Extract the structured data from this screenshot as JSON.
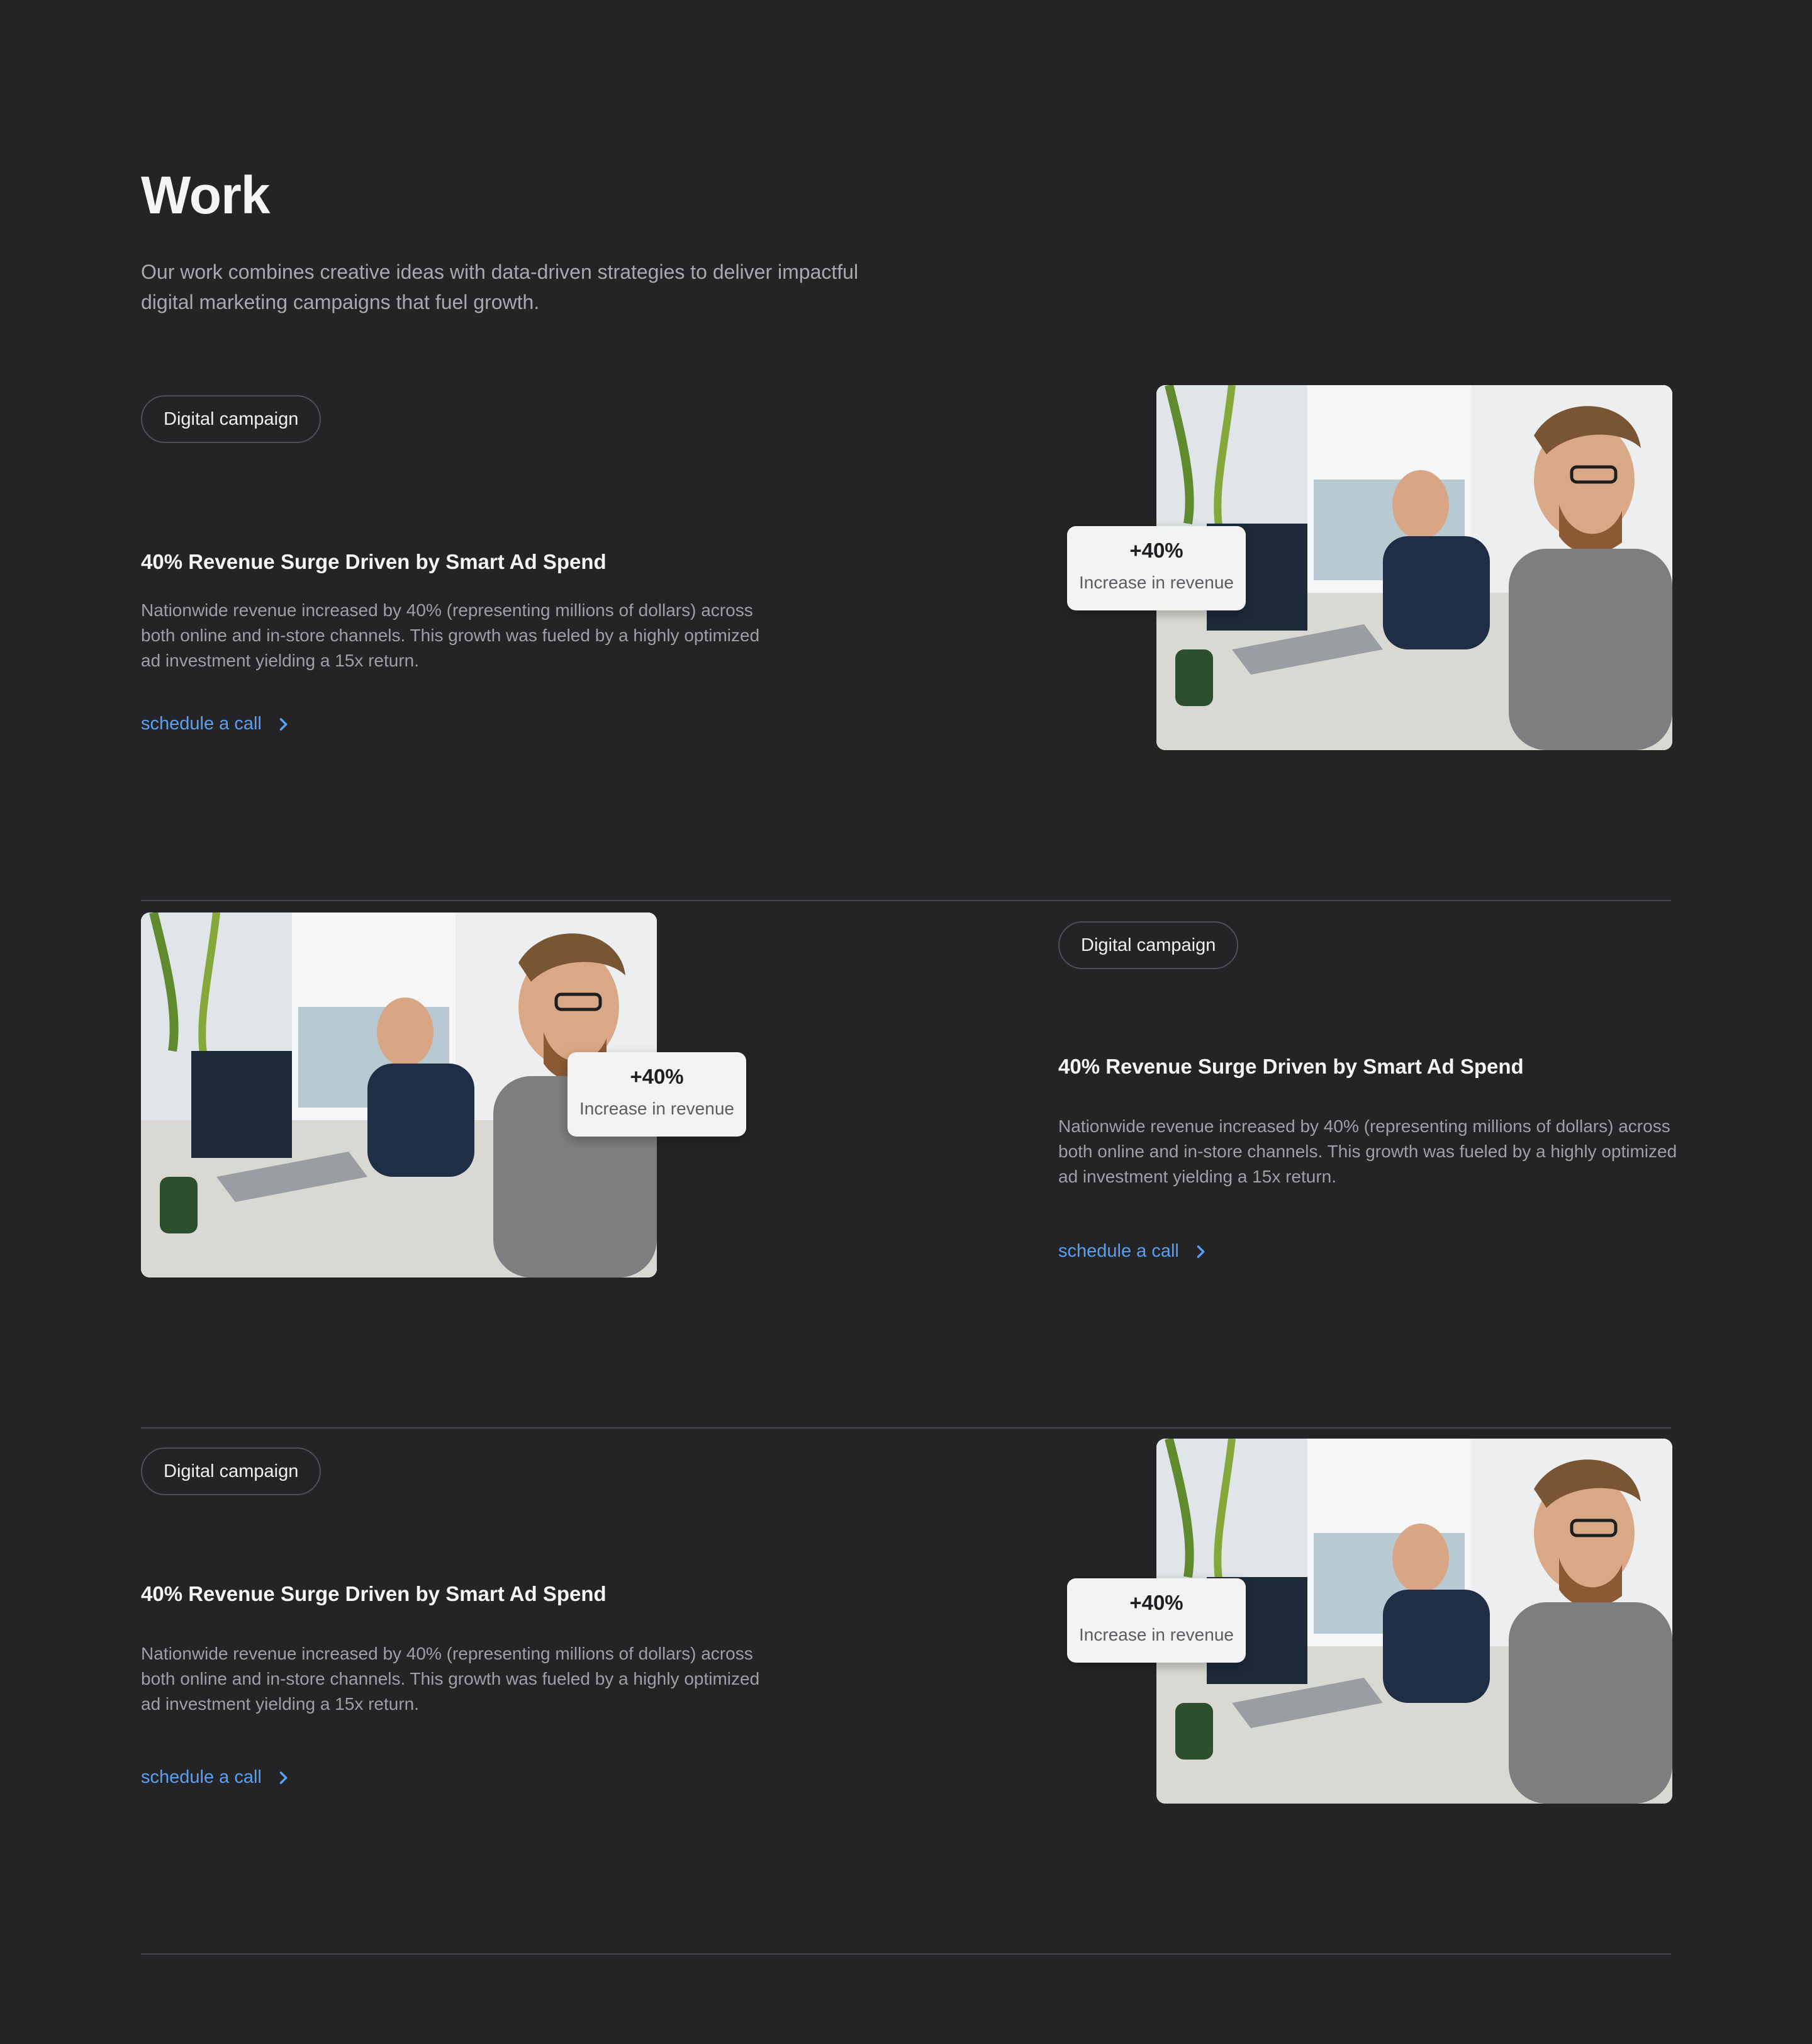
{
  "header": {
    "title": "Work",
    "subtitle": "Our work combines creative ideas with data-driven strategies to deliver impactful digital marketing campaigns that fuel growth."
  },
  "cases": [
    {
      "tag": "Digital campaign",
      "title": "40% Revenue Surge Driven by Smart Ad Spend",
      "description": "Nationwide revenue increased by 40% (representing millions of dollars) across both online and in-store channels. This growth was fueled by a highly optimized ad investment yielding a 15x return.",
      "cta": "schedule a call",
      "stat_value": "+40%",
      "stat_label": "Increase in revenue",
      "image_alt": "Two men working at laptops in an office",
      "layout": "image-right"
    },
    {
      "tag": "Digital campaign",
      "title": "40% Revenue Surge Driven by Smart Ad Spend",
      "description": "Nationwide revenue increased by 40% (representing millions of dollars) across both online and in-store channels. This growth was fueled by a highly optimized ad investment yielding a 15x return.",
      "cta": "schedule a call",
      "stat_value": "+40%",
      "stat_label": "Increase in revenue",
      "image_alt": "Two men working at laptops in an office",
      "layout": "image-left"
    },
    {
      "tag": "Digital campaign",
      "title": "40% Revenue Surge Driven by Smart Ad Spend",
      "description": "Nationwide revenue increased by 40% (representing millions of dollars) across both online and in-store channels. This growth was fueled by a highly optimized ad investment yielding a 15x return.",
      "cta": "schedule a call",
      "stat_value": "+40%",
      "stat_label": "Increase in revenue",
      "image_alt": "Two men working at laptops in an office",
      "layout": "image-right"
    }
  ],
  "icons": {
    "cta_arrow": "chevron-right-icon"
  },
  "colors": {
    "background": "#242427",
    "accent_link": "#5aa0f2",
    "divider": "#44444a",
    "card": "#f3f3f4"
  }
}
